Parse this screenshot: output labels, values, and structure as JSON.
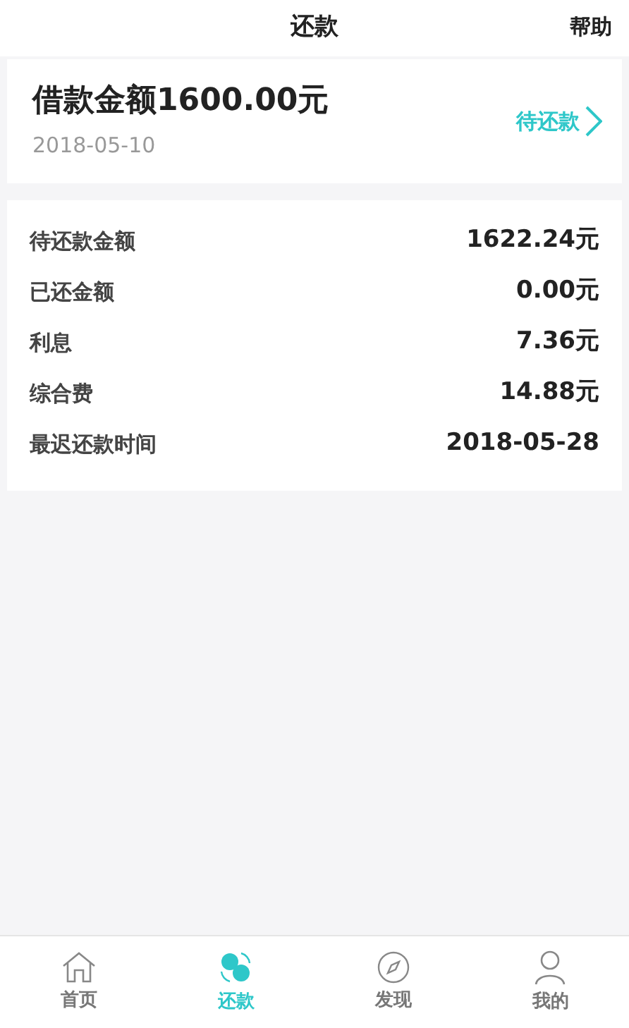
{
  "header": {
    "title": "还款",
    "help": "帮助"
  },
  "loan": {
    "title": "借款金额1600.00元",
    "date": "2018-05-10",
    "status": "待还款"
  },
  "details": [
    {
      "label": "待还款金额",
      "value": "1622.24元"
    },
    {
      "label": "已还金额",
      "value": "0.00元"
    },
    {
      "label": "利息",
      "value": "7.36元"
    },
    {
      "label": "综合费",
      "value": "14.88元"
    },
    {
      "label": "最迟还款时间",
      "value": "2018-05-28"
    }
  ],
  "tabs": [
    {
      "kind": "home",
      "label": "首页",
      "selected": false
    },
    {
      "kind": "repay",
      "label": "还款",
      "selected": true
    },
    {
      "kind": "discover",
      "label": "发现",
      "selected": false
    },
    {
      "kind": "profile",
      "label": "我的",
      "selected": false
    }
  ]
}
